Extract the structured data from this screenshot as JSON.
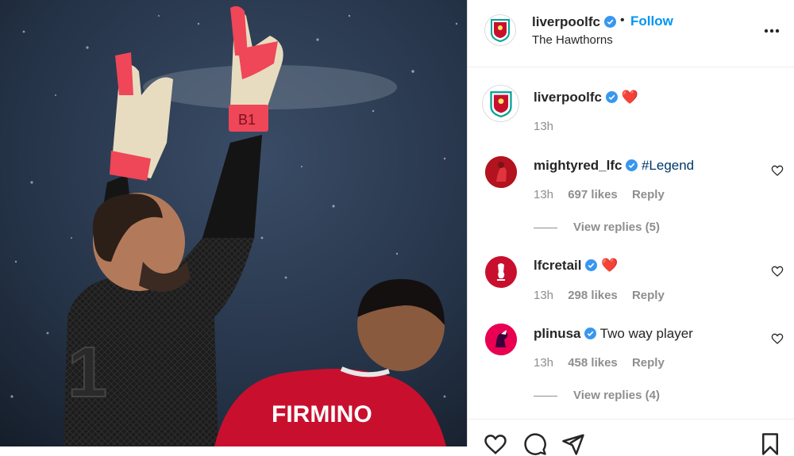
{
  "post": {
    "username": "liverpoolfc",
    "follow_label": "Follow",
    "separator": "•",
    "location": "The Hawthorns"
  },
  "photo": {
    "glove_text": "B1",
    "shirt_name": "FIRMINO"
  },
  "caption": {
    "username": "liverpoolfc",
    "emoji": "❤️",
    "time": "13h"
  },
  "comments": [
    {
      "username": "mightyred_lfc",
      "text": "#Legend",
      "time": "13h",
      "likes": "697 likes",
      "reply": "Reply",
      "view_replies": "View replies (5)"
    },
    {
      "username": "lfcretail",
      "text": "❤️",
      "time": "13h",
      "likes": "298 likes",
      "reply": "Reply"
    },
    {
      "username": "plinusa",
      "text": "Two way player",
      "time": "13h",
      "likes": "458 likes",
      "reply": "Reply",
      "view_replies": "View replies (4)"
    }
  ],
  "colors": {
    "accent": "#0095f6",
    "verified": "#3897f0",
    "heart": "#ed4956",
    "lfc_red": "#c8102e",
    "muted": "#8e8e8e"
  },
  "icons": [
    "verified-icon",
    "more-options-icon",
    "heart-icon",
    "comment-icon",
    "share-icon",
    "save-icon"
  ]
}
